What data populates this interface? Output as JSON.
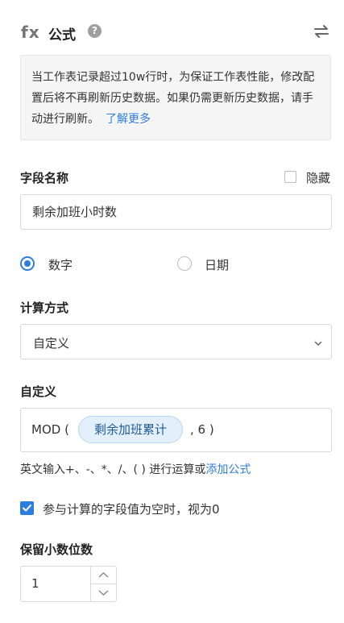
{
  "header": {
    "fx_label": "fx",
    "title": "公式",
    "help_glyph": "?",
    "icons": [
      "help-icon",
      "swap-icon"
    ]
  },
  "notice": {
    "text": "当工作表记录超过10w行时，为保证工作表性能，修改配置后将不再刷新历史数据。如果仍需更新历史数据，请手动进行刷新。",
    "link": "了解更多"
  },
  "field_name": {
    "label": "字段名称",
    "hide_label": "隐藏",
    "hide_checked": false,
    "value": "剩余加班小时数"
  },
  "type_options": [
    {
      "label": "数字",
      "selected": true
    },
    {
      "label": "日期",
      "selected": false
    }
  ],
  "calc": {
    "label": "计算方式",
    "selected": "自定义"
  },
  "custom": {
    "label": "自定义",
    "func": "MOD (",
    "field_token": "剩余加班累计",
    "tail": ", 6 )"
  },
  "hint": {
    "text": "英文输入+、-、*、/、( ) 进行运算或",
    "link": "添加公式"
  },
  "empty_as_zero": {
    "label": "参与计算的字段值为空时，视为0",
    "checked": true
  },
  "decimals": {
    "label": "保留小数位数",
    "value": "1"
  },
  "colors": {
    "accent": "#2d7de0",
    "token_bg": "#e3f0fb",
    "notice_bg": "#f5f5f5"
  }
}
